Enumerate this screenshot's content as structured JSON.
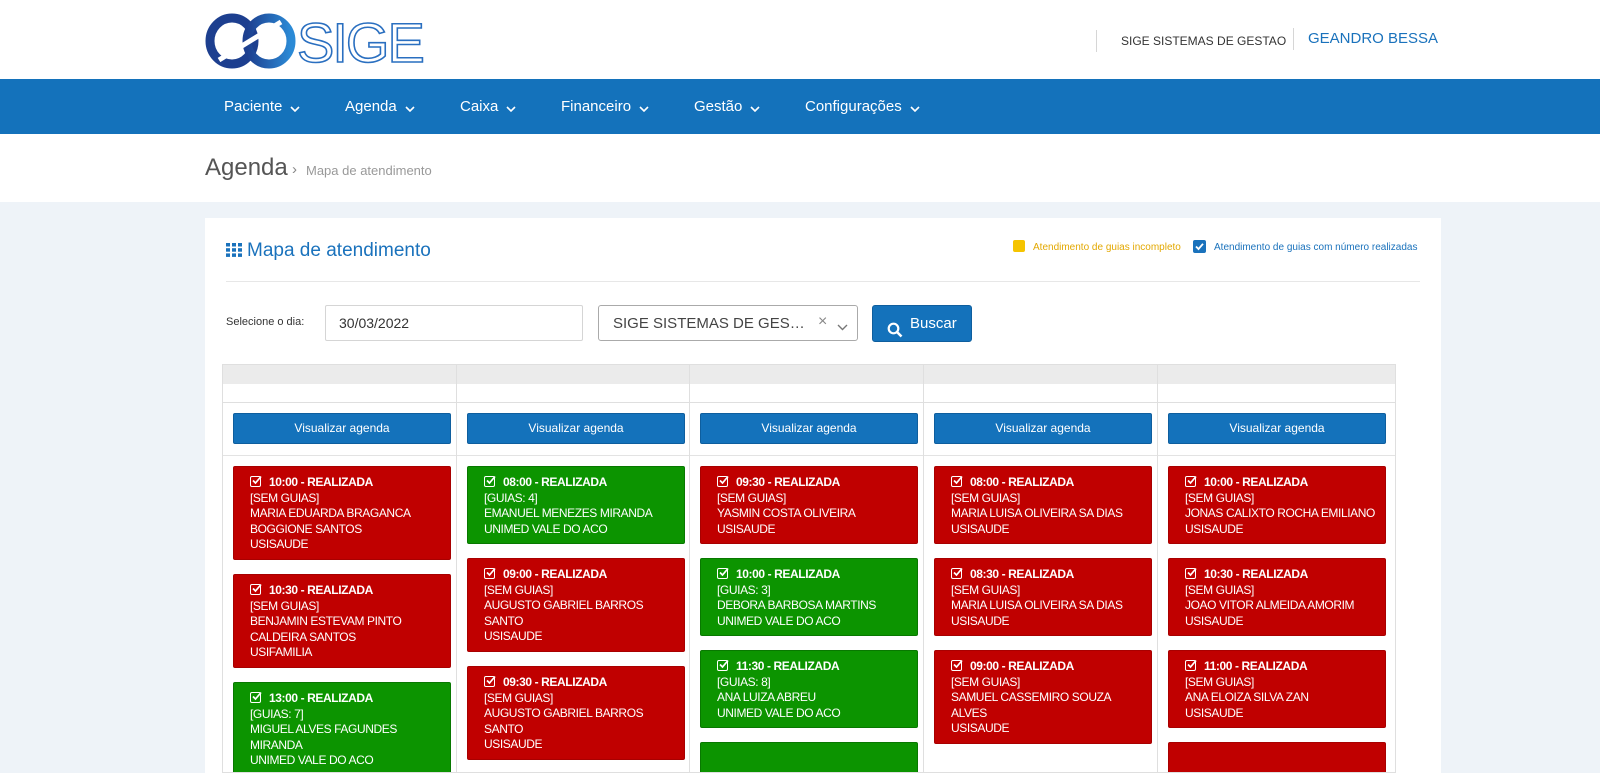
{
  "header": {
    "logo_text": "SIGE",
    "company": "SIGE SISTEMAS DE GESTAO",
    "user": "GEANDRO BESSA"
  },
  "nav": {
    "items": [
      {
        "label": "Paciente"
      },
      {
        "label": "Agenda"
      },
      {
        "label": "Caixa"
      },
      {
        "label": "Financeiro"
      },
      {
        "label": "Gestão"
      },
      {
        "label": "Configurações"
      }
    ]
  },
  "breadcrumb": {
    "title": "Agenda",
    "separator": "›",
    "current": "Mapa de atendimento"
  },
  "panel": {
    "title": "Mapa de atendimento",
    "legend_incomplete": "Atendimento de guias incompleto",
    "legend_done": "Atendimento de guias com número realizadas",
    "select_day_label": "Selecione o dia:",
    "date_value": "30/03/2022",
    "clinic_select_value": "SIGE SISTEMAS DE GES…",
    "clear_symbol": "×",
    "search_button": "Buscar",
    "view_agenda_label": "Visualizar agenda"
  },
  "colors": {
    "primary": "#1472bb",
    "red_card": "#c00000",
    "green_card": "#0c9400",
    "legend_yellow": "#f5c400"
  },
  "columns": [
    {
      "cards": [
        {
          "color": "red",
          "title": "10:00 - REALIZADA",
          "guias": "[SEM GUIAS]",
          "name_lines": [
            "MARIA EDUARDA BRAGANCA",
            "BOGGIONE SANTOS"
          ],
          "insurer": "USISAUDE"
        },
        {
          "color": "red",
          "title": "10:30 - REALIZADA",
          "guias": "[SEM GUIAS]",
          "name_lines": [
            "BENJAMIN ESTEVAM PINTO",
            "CALDEIRA SANTOS"
          ],
          "insurer": "USIFAMILIA"
        },
        {
          "color": "green",
          "title": "13:00 - REALIZADA",
          "guias": "[GUIAS: 7]",
          "name_lines": [
            "MIGUEL ALVES FAGUNDES",
            "MIRANDA"
          ],
          "insurer": "UNIMED VALE DO ACO"
        }
      ]
    },
    {
      "cards": [
        {
          "color": "green",
          "title": "08:00 - REALIZADA",
          "guias": "[GUIAS: 4]",
          "name_lines": [
            "EMANUEL MENEZES MIRANDA"
          ],
          "insurer": "UNIMED VALE DO ACO"
        },
        {
          "color": "red",
          "title": "09:00 - REALIZADA",
          "guias": "[SEM GUIAS]",
          "name_lines": [
            "AUGUSTO GABRIEL BARROS",
            "SANTO"
          ],
          "insurer": "USISAUDE"
        },
        {
          "color": "red",
          "title": "09:30 - REALIZADA",
          "guias": "[SEM GUIAS]",
          "name_lines": [
            "AUGUSTO GABRIEL BARROS",
            "SANTO"
          ],
          "insurer": "USISAUDE"
        }
      ]
    },
    {
      "cards": [
        {
          "color": "red",
          "title": "09:30 - REALIZADA",
          "guias": "[SEM GUIAS]",
          "name_lines": [
            "YASMIN COSTA OLIVEIRA"
          ],
          "insurer": "USISAUDE"
        },
        {
          "color": "green",
          "title": "10:00 - REALIZADA",
          "guias": "[GUIAS: 3]",
          "name_lines": [
            "DEBORA BARBOSA MARTINS"
          ],
          "insurer": "UNIMED VALE DO ACO"
        },
        {
          "color": "green",
          "title": "11:30 - REALIZADA",
          "guias": "[GUIAS: 8]",
          "name_lines": [
            "ANA LUIZA ABREU"
          ],
          "insurer": "UNIMED VALE DO ACO"
        },
        {
          "color": "green",
          "title": "",
          "guias": "",
          "name_lines": [],
          "insurer": ""
        }
      ]
    },
    {
      "cards": [
        {
          "color": "red",
          "title": "08:00 - REALIZADA",
          "guias": "[SEM GUIAS]",
          "name_lines": [
            "MARIA LUISA OLIVEIRA SA DIAS"
          ],
          "insurer": "USISAUDE"
        },
        {
          "color": "red",
          "title": "08:30 - REALIZADA",
          "guias": "[SEM GUIAS]",
          "name_lines": [
            "MARIA LUISA OLIVEIRA SA DIAS"
          ],
          "insurer": "USISAUDE"
        },
        {
          "color": "red",
          "title": "09:00 - REALIZADA",
          "guias": "[SEM GUIAS]",
          "name_lines": [
            "SAMUEL CASSEMIRO SOUZA",
            "ALVES"
          ],
          "insurer": "USISAUDE"
        }
      ]
    },
    {
      "cards": [
        {
          "color": "red",
          "title": "10:00 - REALIZADA",
          "guias": "[SEM GUIAS]",
          "name_lines": [
            "JONAS CALIXTO ROCHA EMILIANO"
          ],
          "insurer": "USISAUDE"
        },
        {
          "color": "red",
          "title": "10:30 - REALIZADA",
          "guias": "[SEM GUIAS]",
          "name_lines": [
            "JOAO VITOR ALMEIDA AMORIM"
          ],
          "insurer": "USISAUDE"
        },
        {
          "color": "red",
          "title": "11:00 - REALIZADA",
          "guias": "[SEM GUIAS]",
          "name_lines": [
            "ANA ELOIZA SILVA ZAN"
          ],
          "insurer": "USISAUDE"
        },
        {
          "color": "red",
          "title": "",
          "guias": "",
          "name_lines": [],
          "insurer": ""
        }
      ]
    }
  ]
}
